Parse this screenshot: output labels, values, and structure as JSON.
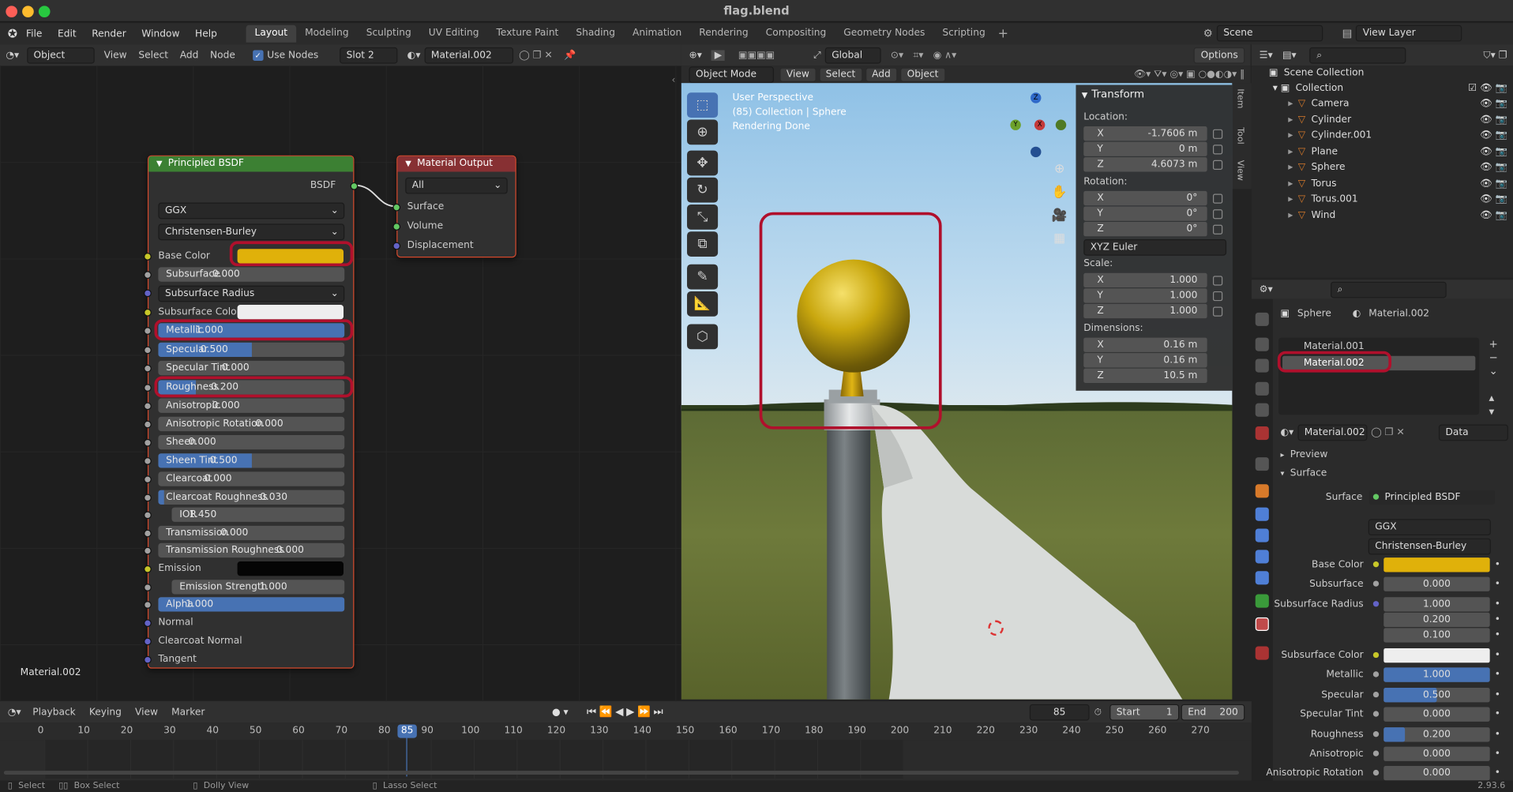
{
  "window": {
    "title": "flag.blend"
  },
  "menu": [
    "File",
    "Edit",
    "Render",
    "Window",
    "Help"
  ],
  "workspaces": [
    "Layout",
    "Modeling",
    "Sculpting",
    "UV Editing",
    "Texture Paint",
    "Shading",
    "Animation",
    "Rendering",
    "Compositing",
    "Geometry Nodes",
    "Scripting"
  ],
  "active_workspace": "Layout",
  "scene": {
    "label": "Scene",
    "view_layer": "View Layer"
  },
  "node_header": {
    "mode": "Object",
    "items": [
      "View",
      "Select",
      "Add",
      "Node"
    ],
    "use_nodes": "Use Nodes",
    "slot": "Slot 2",
    "material": "Material.002"
  },
  "bsdf_node": {
    "title": "Principled BSDF",
    "output": "BSDF",
    "distribution": "GGX",
    "subsurface_method": "Christensen-Burley",
    "rows": [
      {
        "label": "Base Color",
        "type": "color",
        "color": "#e0b10a"
      },
      {
        "label": "Subsurface",
        "value": "0.000",
        "fill": 0
      },
      {
        "label": "Subsurface Radius",
        "type": "dropdown"
      },
      {
        "label": "Subsurface Color",
        "type": "color",
        "color": "#eeeeee"
      },
      {
        "label": "Metallic",
        "value": "1.000",
        "fill": 1
      },
      {
        "label": "Specular",
        "value": "0.500",
        "fill": 0.5
      },
      {
        "label": "Specular Tint",
        "value": "0.000",
        "fill": 0
      },
      {
        "label": "Roughness",
        "value": "0.200",
        "fill": 0.2
      },
      {
        "label": "Anisotropic",
        "value": "0.000",
        "fill": 0
      },
      {
        "label": "Anisotropic Rotation",
        "value": "0.000",
        "fill": 0
      },
      {
        "label": "Sheen",
        "value": "0.000",
        "fill": 0
      },
      {
        "label": "Sheen Tint",
        "value": "0.500",
        "fill": 0.5
      },
      {
        "label": "Clearcoat",
        "value": "0.000",
        "fill": 0
      },
      {
        "label": "Clearcoat Roughness",
        "value": "0.030",
        "fill": 0.03
      },
      {
        "label": "IOR",
        "value": "1.450",
        "fill": 0
      },
      {
        "label": "Transmission",
        "value": "0.000",
        "fill": 0
      },
      {
        "label": "Transmission Roughness",
        "value": "0.000",
        "fill": 0
      },
      {
        "label": "Emission",
        "type": "color",
        "color": "#050505"
      },
      {
        "label": "Emission Strength",
        "value": "1.000",
        "fill": 0
      },
      {
        "label": "Alpha",
        "value": "1.000",
        "fill": 1
      },
      {
        "label": "Normal",
        "type": "socket"
      },
      {
        "label": "Clearcoat Normal",
        "type": "socket"
      },
      {
        "label": "Tangent",
        "type": "socket"
      }
    ]
  },
  "output_node": {
    "title": "Material Output",
    "target": "All",
    "inputs": [
      "Surface",
      "Volume",
      "Displacement"
    ]
  },
  "node_editor_material": "Material.002",
  "viewport": {
    "mode": "Object Mode",
    "menu": [
      "View",
      "Select",
      "Add",
      "Object"
    ],
    "info": [
      "User Perspective",
      "(85) Collection | Sphere",
      "Rendering Done"
    ],
    "orientation": "Global",
    "options": "Options"
  },
  "transform": {
    "title": "Transform",
    "location_label": "Location:",
    "location": [
      [
        "X",
        "-1.7606 m"
      ],
      [
        "Y",
        "0 m"
      ],
      [
        "Z",
        "4.6073 m"
      ]
    ],
    "rotation_label": "Rotation:",
    "rotation": [
      [
        "X",
        "0°"
      ],
      [
        "Y",
        "0°"
      ],
      [
        "Z",
        "0°"
      ]
    ],
    "rotation_mode": "XYZ Euler",
    "scale_label": "Scale:",
    "scale": [
      [
        "X",
        "1.000"
      ],
      [
        "Y",
        "1.000"
      ],
      [
        "Z",
        "1.000"
      ]
    ],
    "dimensions_label": "Dimensions:",
    "dimensions": [
      [
        "X",
        "0.16 m"
      ],
      [
        "Y",
        "0.16 m"
      ],
      [
        "Z",
        "10.5 m"
      ]
    ]
  },
  "side_tabs": [
    "Item",
    "Tool",
    "View"
  ],
  "outliner": {
    "root": "Scene Collection",
    "collection": "Collection",
    "objects": [
      "Camera",
      "Cylinder",
      "Cylinder.001",
      "Plane",
      "Sphere",
      "Torus",
      "Torus.001",
      "Wind"
    ]
  },
  "properties": {
    "object": "Sphere",
    "material": "Material.002",
    "slots": [
      "Material.001",
      "Material.002"
    ],
    "mat_name": "Material.002",
    "link": "Data",
    "preview": "Preview",
    "surface_panel": "Surface",
    "surface_label": "Surface",
    "surface_value": "Principled BSDF",
    "ggx": "GGX",
    "cb": "Christensen-Burley",
    "rows": [
      {
        "label": "Base Color",
        "type": "color",
        "color": "#e0b10a"
      },
      {
        "label": "Subsurface",
        "value": "0.000"
      },
      {
        "label": "Subsurface Radius",
        "value": "1.000"
      },
      {
        "label": "",
        "value": "0.200"
      },
      {
        "label": "",
        "value": "0.100"
      },
      {
        "label": "Subsurface Color",
        "type": "color",
        "color": "#eeeeee"
      },
      {
        "label": "Metallic",
        "value": "1.000",
        "fill": 1
      },
      {
        "label": "Specular",
        "value": "0.500",
        "fill": 0.5
      },
      {
        "label": "Specular Tint",
        "value": "0.000"
      },
      {
        "label": "Roughness",
        "value": "0.200",
        "fill": 0.2
      },
      {
        "label": "Anisotropic",
        "value": "0.000"
      },
      {
        "label": "Anisotropic Rotation",
        "value": "0.000"
      }
    ]
  },
  "timeline": {
    "menu": [
      "Playback",
      "Keying",
      "View",
      "Marker"
    ],
    "current": "85",
    "start_label": "Start",
    "start": "1",
    "end_label": "End",
    "end": "200",
    "ticks": [
      "0",
      "10",
      "20",
      "30",
      "40",
      "50",
      "60",
      "70",
      "80",
      "90",
      "100",
      "110",
      "120",
      "130",
      "140",
      "150",
      "160",
      "170",
      "180",
      "190",
      "200",
      "210",
      "220",
      "230",
      "240",
      "250",
      "260",
      "270"
    ]
  },
  "status": {
    "select": "Select",
    "box_select": "Box Select",
    "dolly": "Dolly View",
    "lasso": "Lasso Select",
    "version": "2.93.6"
  }
}
